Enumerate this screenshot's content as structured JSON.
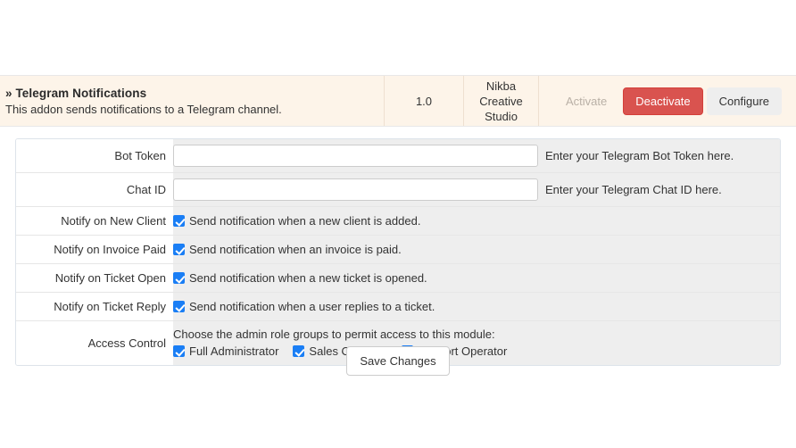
{
  "addon": {
    "title": "» Telegram Notifications",
    "description": "This addon sends notifications to a Telegram channel.",
    "version": "1.0",
    "author": "Nikba Creative Studio",
    "actions": {
      "activate_label": "Activate",
      "deactivate_label": "Deactivate",
      "configure_label": "Configure"
    },
    "colors": {
      "strip_background": "#fdf4e9",
      "deactivate_background": "#d9534f",
      "configure_background": "#eeeeee",
      "activate_text": "#b9b0a6"
    }
  },
  "settings": {
    "fields": [
      {
        "label": "Bot Token",
        "type": "text",
        "value": "",
        "placeholder": "",
        "help": "Enter your Telegram Bot Token here."
      },
      {
        "label": "Chat ID",
        "type": "text",
        "value": "",
        "placeholder": "",
        "help": "Enter your Telegram Chat ID here."
      },
      {
        "label": "Notify on New Client",
        "type": "checkbox",
        "checked": true,
        "checkbox_label": "Send notification when a new client is added."
      },
      {
        "label": "Notify on Invoice Paid",
        "type": "checkbox",
        "checked": true,
        "checkbox_label": "Send notification when an invoice is paid."
      },
      {
        "label": "Notify on Ticket Open",
        "type": "checkbox",
        "checked": true,
        "checkbox_label": "Send notification when a new ticket is opened."
      },
      {
        "label": "Notify on Ticket Reply",
        "type": "checkbox",
        "checked": true,
        "checkbox_label": "Send notification when a user replies to a ticket."
      }
    ],
    "access_control": {
      "label": "Access Control",
      "intro": "Choose the admin role groups to permit access to this module:",
      "groups": [
        {
          "label": "Full Administrator",
          "checked": true
        },
        {
          "label": "Sales Operator",
          "checked": true
        },
        {
          "label": "Support Operator",
          "checked": true
        }
      ]
    },
    "checkbox_color": "#1a7ef5"
  },
  "footer": {
    "save_label": "Save Changes"
  }
}
